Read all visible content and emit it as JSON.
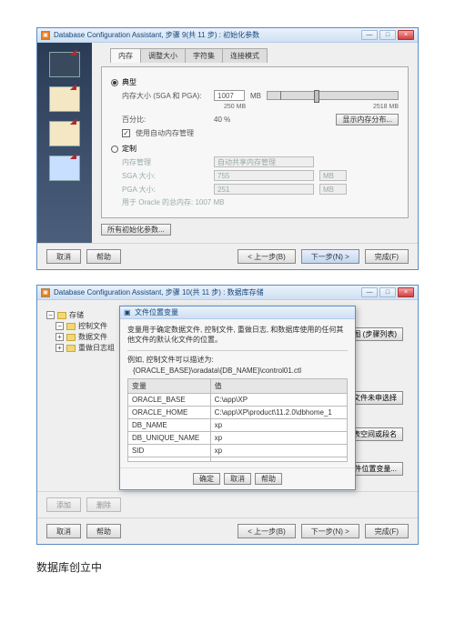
{
  "win1": {
    "title": "Database Configuration Assistant, 步骤 9(共 11 步) : 初始化参数",
    "winbuttons": {
      "min": "—",
      "max": "□",
      "close": "×"
    },
    "tabs": [
      "内存",
      "调整大小",
      "字符集",
      "连接模式"
    ],
    "section_typical": "典型",
    "mem_size_label": "内存大小 (SGA 和 PGA):",
    "mem_size_value": "1007",
    "mem_unit": "MB",
    "scale_mid": "250 MB",
    "scale_max": "2518 MB",
    "percent_label": "百分比:",
    "percent_value": "40 %",
    "show_dist_btn": "显示内存分布...",
    "auto_mgmt": "使用自动内存管理",
    "section_custom": "定制",
    "mgmt_label": "内存管理",
    "mgmt_value": "自动共享内存管理",
    "sga_label": "SGA 大小:",
    "sga_value": "755",
    "pga_label": "PGA 大小:",
    "pga_value": "251",
    "size_unit_mb": "MB",
    "total_label": "用于 Oracle 的总内存: 1007 MB",
    "all_params_btn": "所有初始化参数...",
    "footer": {
      "cancel": "取消",
      "help": "帮助",
      "back": "< 上一步(B)",
      "next": "下一步(N) >",
      "finish": "完成(F)"
    }
  },
  "win2": {
    "title": "Database Configuration Assistant, 步骤 10(共 11 步) : 数据库存储",
    "tree": {
      "root": "存储",
      "c1": "控制文件",
      "c2": "数据文件",
      "c3": "重做日志组"
    },
    "bg_btns": {
      "b1": "以数据库区域表视图 (步骤列表)",
      "b2": "所有类型文件未申选择",
      "b3": "文件, 表空间或段名",
      "b4": "文件位置变量..."
    },
    "footer": {
      "cancel": "取消",
      "help": "帮助",
      "back": "< 上一步(B)",
      "next": "下一步(N) >",
      "finish": "完成(F)"
    },
    "footer_left": {
      "add": "添加",
      "del": "删除"
    },
    "modal": {
      "title": "文件位置变量",
      "desc": "变量用于确定数据文件, 控制文件, 重做日志, 和数据库使用的任何其他文件的默认化文件的位置。",
      "example_h": "例如, 控制文件可以描述为:",
      "example": "{ORACLE_BASE}\\oradata\\{DB_NAME}\\control01.ctl",
      "th_var": "变量",
      "th_val": "值",
      "rows": [
        {
          "v": "ORACLE_BASE",
          "val": "C:\\app\\XP"
        },
        {
          "v": "ORACLE_HOME",
          "val": "C:\\app\\XP\\product\\11.2.0\\dbhome_1"
        },
        {
          "v": "DB_NAME",
          "val": "xp"
        },
        {
          "v": "DB_UNIQUE_NAME",
          "val": "xp"
        },
        {
          "v": "SID",
          "val": "xp"
        }
      ],
      "ok": "确定",
      "cancel": "取消",
      "help": "帮助"
    }
  },
  "caption": "数据库创立中"
}
